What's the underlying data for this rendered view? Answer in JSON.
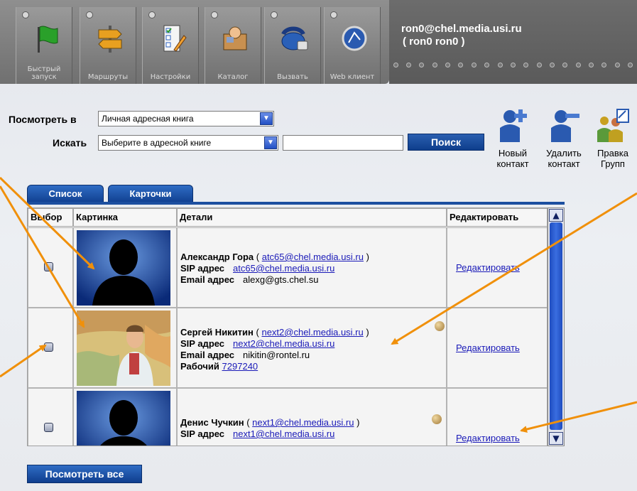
{
  "toolbar": {
    "buttons": [
      {
        "label": "Быстрый запуск",
        "icon": "flag-icon"
      },
      {
        "label": "Маршруты",
        "icon": "route-sign-icon"
      },
      {
        "label": "Настройки",
        "icon": "settings-checklist-icon"
      },
      {
        "label": "Каталог",
        "icon": "catalog-icon"
      },
      {
        "label": "Вызвать",
        "icon": "phone-icon"
      },
      {
        "label": "Web клиент",
        "icon": "web-client-icon"
      }
    ],
    "user_email": "ron0@chel.media.usi.ru",
    "user_name": "( ron0 ron0 )"
  },
  "search": {
    "view_in_label": "Посмотреть в",
    "view_in_value": "Личная адресная книга",
    "search_label": "Искать",
    "search_in_value": "Выберите в адресной книге",
    "query": "",
    "search_button": "Поиск"
  },
  "actions": {
    "new_contact": "Новый контакт",
    "delete_contact": "Удалить контакт",
    "edit_groups": "Правка Групп"
  },
  "tabs": {
    "list": "Список",
    "cards": "Карточки"
  },
  "table": {
    "headers": {
      "select": "Выбор",
      "picture": "Картинка",
      "details": "Детали",
      "edit": "Редактировать"
    },
    "rows": [
      {
        "name": "Александр Гора",
        "name_link": "atc65@chel.media.usi.ru",
        "sip_label": "SIP адрес",
        "sip": "atc65@chel.media.usi.ru",
        "email_label": "Email адрес",
        "email": "alexg@gts.chel.su",
        "edit": "Редактировать"
      },
      {
        "name": "Сергей Никитин",
        "name_link": "next2@chel.media.usi.ru",
        "sip_label": "SIP адрес",
        "sip": "next2@chel.media.usi.ru",
        "email_label": "Email адрес",
        "email": "nikitin@rontel.ru",
        "work_label": "Рабочий",
        "work": "7297240",
        "edit": "Редактировать"
      },
      {
        "name": "Денис Чучкин",
        "name_link": "next1@chel.media.usi.ru",
        "sip_label": "SIP адрес",
        "sip": "next1@chel.media.usi.ru",
        "edit": "Редактировать"
      }
    ]
  },
  "view_all_button": "Посмотреть все",
  "colors": {
    "accent_blue": "#1c4fa0",
    "annotation_orange": "#f0900a",
    "link": "#1a1ab8"
  }
}
